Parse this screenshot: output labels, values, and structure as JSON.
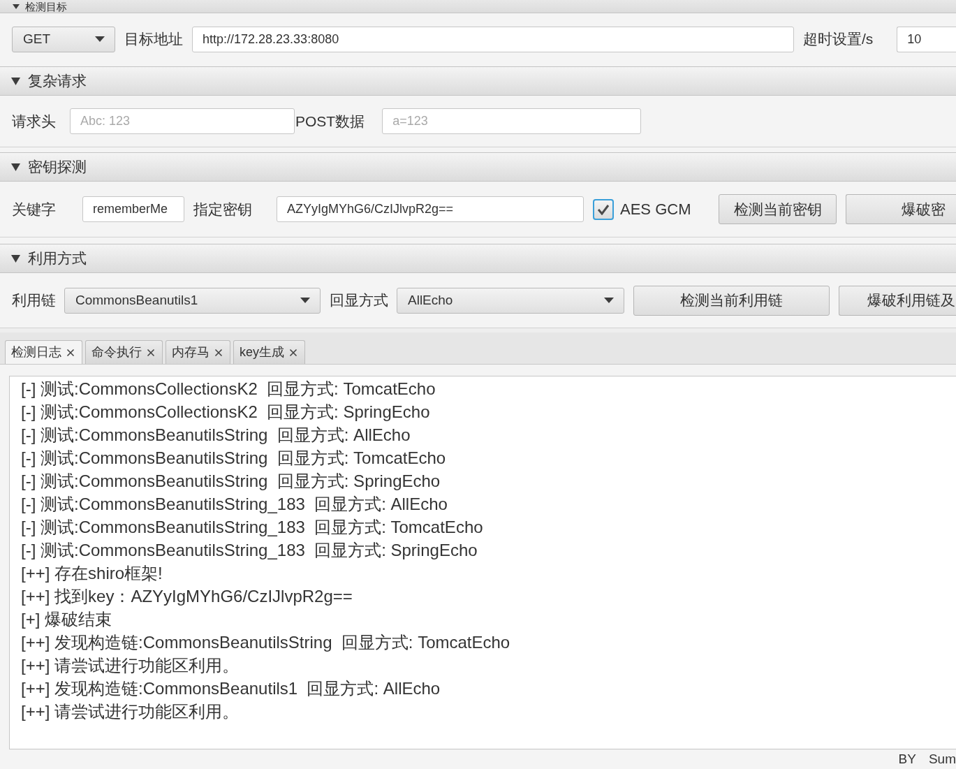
{
  "target": {
    "title": "检测目标",
    "expanded": true,
    "method": "GET",
    "url": {
      "label": "目标地址",
      "value": "http://172.28.23.33:8080"
    },
    "timeout": {
      "label": "超时设置/s",
      "value": "10"
    }
  },
  "complex_request": {
    "title": "复杂请求",
    "expanded": true,
    "headers": {
      "label": "请求头",
      "placeholder": "Abc: 123"
    },
    "post_data": {
      "label": "POST数据",
      "placeholder": "a=123"
    }
  },
  "key_detection": {
    "title": "密钥探测",
    "expanded": true,
    "keyword": {
      "label": "关键字",
      "value": "rememberMe"
    },
    "key": {
      "label": "指定密钥",
      "value": "AZYyIgMYhG6/CzIJlvpR2g=="
    },
    "aes_gcm": {
      "label": "AES GCM",
      "checked": true
    },
    "buttons": [
      "检测当前密钥",
      "爆破密"
    ]
  },
  "exploit": {
    "title": "利用方式",
    "expanded": true,
    "chain": {
      "label": "利用链",
      "value": "CommonsBeanutils1"
    },
    "echo": {
      "label": "回显方式",
      "value": "AllEcho"
    },
    "buttons": [
      "检测当前利用链",
      "爆破利用链及"
    ]
  },
  "tabs": [
    {
      "label": "检测日志",
      "selected": true
    },
    {
      "label": "命令执行",
      "selected": false
    },
    {
      "label": "内存马",
      "selected": false
    },
    {
      "label": "key生成",
      "selected": false
    }
  ],
  "log": [
    "[-] 测试:CommonsCollectionsK2  回显方式: TomcatEcho",
    "[-] 测试:CommonsCollectionsK2  回显方式: SpringEcho",
    "[-] 测试:CommonsBeanutilsString  回显方式: AllEcho",
    "[-] 测试:CommonsBeanutilsString  回显方式: TomcatEcho",
    "[-] 测试:CommonsBeanutilsString  回显方式: SpringEcho",
    "[-] 测试:CommonsBeanutilsString_183  回显方式: AllEcho",
    "[-] 测试:CommonsBeanutilsString_183  回显方式: TomcatEcho",
    "[-] 测试:CommonsBeanutilsString_183  回显方式: SpringEcho",
    "[++] 存在shiro框架!",
    "[++] 找到key：AZYyIgMYhG6/CzIJlvpR2g==",
    "[+] 爆破结束",
    "[++] 发现构造链:CommonsBeanutilsString  回显方式: TomcatEcho",
    "[++] 请尝试进行功能区利用。",
    "[++] 发现构造链:CommonsBeanutils1  回显方式: AllEcho",
    "[++] 请尝试进行功能区利用。"
  ],
  "status_bar": [
    "BY",
    "Sum"
  ]
}
